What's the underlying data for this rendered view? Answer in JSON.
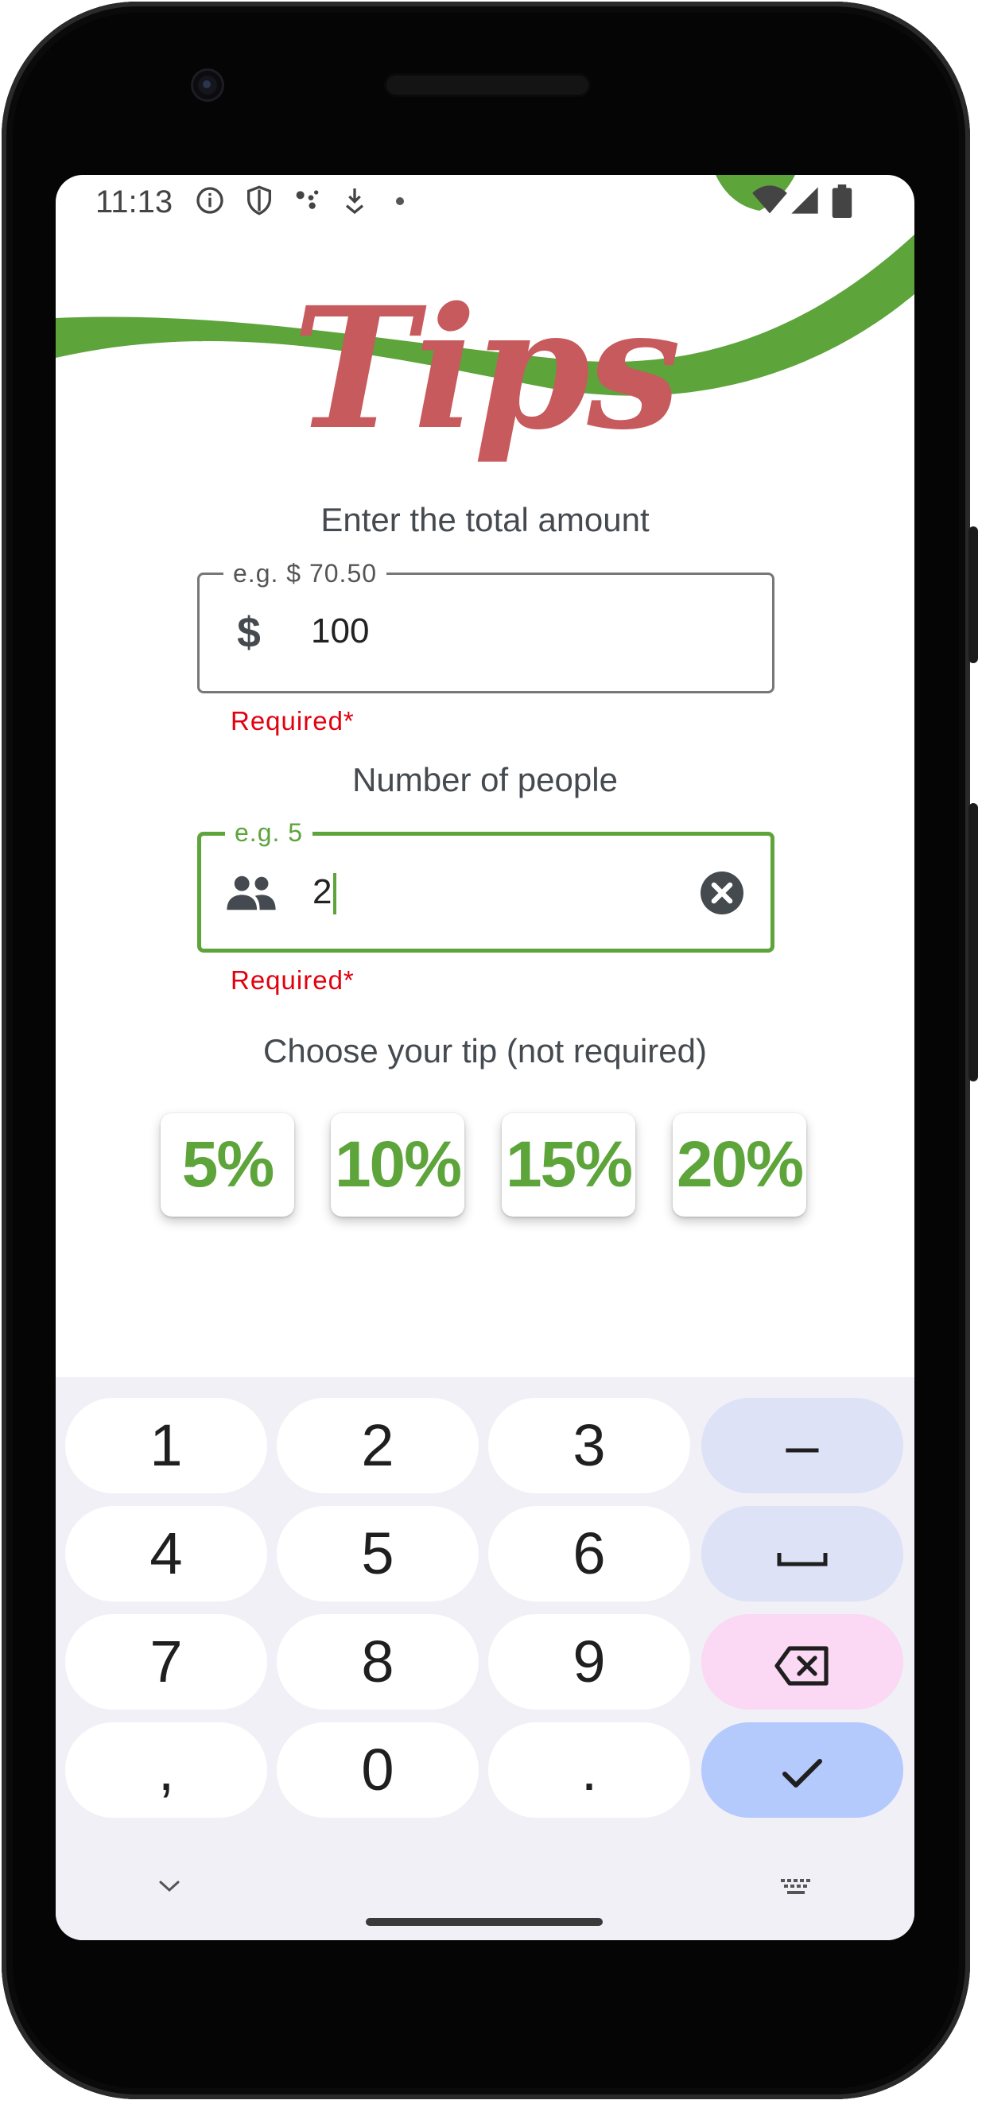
{
  "status_bar": {
    "time": "11:13",
    "icons": [
      "info-icon",
      "shield-icon",
      "assistant-icon",
      "download-icon",
      "dot-icon",
      "wifi-icon",
      "signal-icon",
      "battery-icon"
    ]
  },
  "app": {
    "title": "Tips",
    "title_color": "#c75a5c",
    "accent_color": "#5da43b",
    "error_color": "#e3000f"
  },
  "amount": {
    "label": "Enter the total amount",
    "placeholder": "e.g. $ 70.50",
    "prefix_icon": "dollar-icon",
    "value": "100",
    "error": "Required*"
  },
  "people": {
    "label": "Number of people",
    "placeholder": "e.g. 5",
    "prefix_icon": "people-icon",
    "value": "2",
    "error": "Required*",
    "focused": true
  },
  "tip": {
    "label": "Choose your tip (not required)",
    "options": [
      "5%",
      "10%",
      "15%",
      "20%"
    ]
  },
  "keyboard": {
    "rows": [
      [
        "1",
        "2",
        "3",
        "–"
      ],
      [
        "4",
        "5",
        "6",
        "space"
      ],
      [
        "7",
        "8",
        "9",
        "backspace"
      ],
      [
        ",",
        "0",
        ".",
        "done"
      ]
    ],
    "labels": {
      "k1": "1",
      "k2": "2",
      "k3": "3",
      "minus": "–",
      "k4": "4",
      "k5": "5",
      "k6": "6",
      "k7": "7",
      "k8": "8",
      "k9": "9",
      "comma": ",",
      "k0": "0",
      "period": "."
    }
  }
}
